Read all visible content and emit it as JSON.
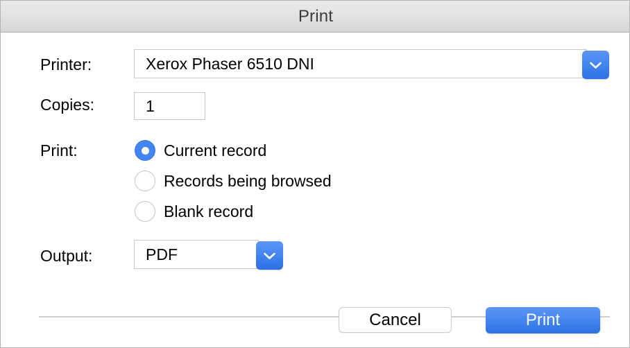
{
  "window": {
    "title": "Print"
  },
  "form": {
    "printer": {
      "label": "Printer:",
      "value": "Xerox Phaser 6510 DNI",
      "dropdown_icon": "chevron-down-icon"
    },
    "copies": {
      "label": "Copies:",
      "value": "1"
    },
    "print_range": {
      "label": "Print:",
      "options": [
        {
          "label": "Current record",
          "selected": true
        },
        {
          "label": "Records being browsed",
          "selected": false
        },
        {
          "label": "Blank record",
          "selected": false
        }
      ]
    },
    "output": {
      "label": "Output:",
      "value": "PDF",
      "dropdown_icon": "chevron-down-icon"
    }
  },
  "footer": {
    "cancel_label": "Cancel",
    "print_label": "Print"
  },
  "colors": {
    "accent": "#4285f0",
    "accent_light": "#5d95f6",
    "accent_dark": "#2f6fe2",
    "titlebar_top": "#eaeaea",
    "titlebar_bottom": "#d6d6d6",
    "field_border": "#c9c9c9",
    "divider": "#cfcfcf"
  }
}
